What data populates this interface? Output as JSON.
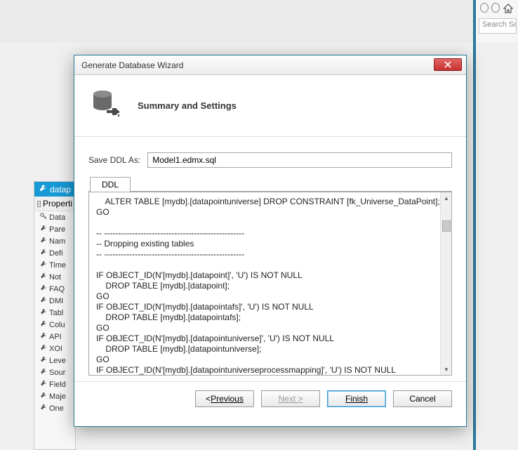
{
  "top": {
    "search_placeholder": "Search Solut"
  },
  "left": {
    "header": "datap",
    "group": "Properti",
    "rows": [
      "Data",
      "Pare",
      "Nam",
      "Defi",
      "Time",
      "Not",
      "FAQ",
      "DMI",
      "Tabl",
      "Colu",
      "API",
      "XOI",
      "Leve",
      "Sour",
      "Field",
      "Maje",
      "One"
    ]
  },
  "dialog": {
    "title": "Generate Database Wizard",
    "header": "Summary and Settings",
    "save_label": "Save DDL As:",
    "save_value": "Model1.edmx.sql",
    "tab": "DDL",
    "code": "    ALTER TABLE [mydb].[datapointuniverse] DROP CONSTRAINT [fk_Universe_DataPoint];\nGO\n\n-- --------------------------------------------------\n-- Dropping existing tables\n-- --------------------------------------------------\n\nIF OBJECT_ID(N'[mydb].[datapoint]', 'U') IS NOT NULL\n    DROP TABLE [mydb].[datapoint];\nGO\nIF OBJECT_ID(N'[mydb].[datapointafs]', 'U') IS NOT NULL\n    DROP TABLE [mydb].[datapointafs];\nGO\nIF OBJECT_ID(N'[mydb].[datapointuniverse]', 'U') IS NOT NULL\n    DROP TABLE [mydb].[datapointuniverse];\nGO\nIF OBJECT_ID(N'[mydb].[datapointuniverseprocessmapping]', 'U') IS NOT NULL",
    "buttons": {
      "previous": "Previous",
      "next": "Next >",
      "finish": "Finish",
      "cancel": "Cancel"
    }
  }
}
